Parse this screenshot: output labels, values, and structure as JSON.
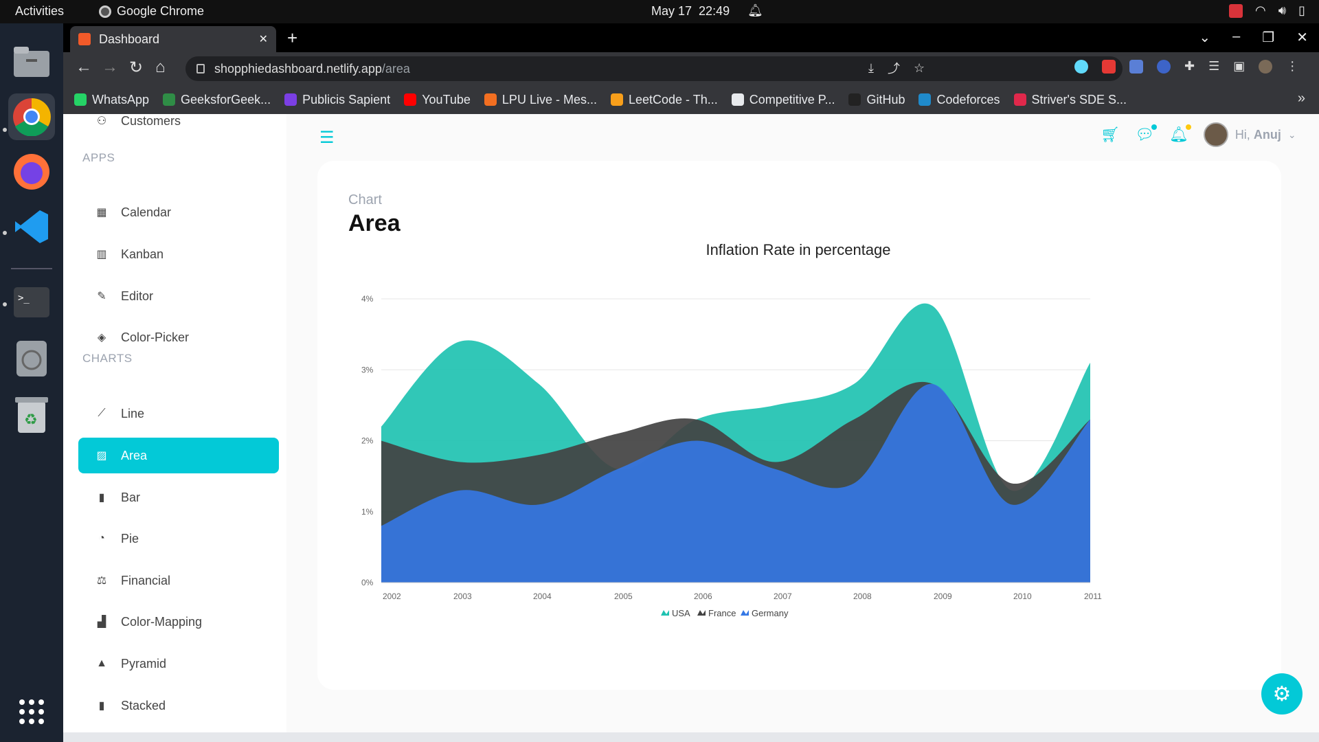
{
  "os": {
    "activities": "Activities",
    "app_name": "Google Chrome",
    "date": "May 17",
    "time": "22:49"
  },
  "browser": {
    "tab_title": "Dashboard",
    "url_host": "shopphiedashboard.netlify.app",
    "url_path": "/area",
    "bookmarks": [
      {
        "label": "WhatsApp",
        "color": "#25d366"
      },
      {
        "label": "GeeksforGeek...",
        "color": "#2f8d46"
      },
      {
        "label": "Publicis Sapient",
        "color": "#7b3fe4"
      },
      {
        "label": "YouTube",
        "color": "#ff0000"
      },
      {
        "label": "LPU Live - Mes...",
        "color": "#f36f21"
      },
      {
        "label": "LeetCode - Th...",
        "color": "#f89f1b"
      },
      {
        "label": "Competitive P...",
        "color": "#e8eaed"
      },
      {
        "label": "GitHub",
        "color": "#222222"
      },
      {
        "label": "Codeforces",
        "color": "#1f8acb"
      },
      {
        "label": "Striver's SDE S...",
        "color": "#e0284b"
      }
    ]
  },
  "sidebar": {
    "items_top": [
      {
        "label": "Customers",
        "icon": "customers-icon",
        "glyph": "⚇"
      }
    ],
    "apps_title": "APPS",
    "apps": [
      {
        "label": "Calendar",
        "icon": "calendar-icon",
        "glyph": "▦"
      },
      {
        "label": "Kanban",
        "icon": "kanban-icon",
        "glyph": "▥"
      },
      {
        "label": "Editor",
        "icon": "editor-icon",
        "glyph": "✎"
      },
      {
        "label": "Color-Picker",
        "icon": "color-picker-icon",
        "glyph": "◈"
      }
    ],
    "charts_title": "CHARTS",
    "charts": [
      {
        "label": "Line",
        "icon": "line-chart-icon",
        "glyph": "⟋"
      },
      {
        "label": "Area",
        "icon": "area-chart-icon",
        "glyph": "▨",
        "active": true
      },
      {
        "label": "Bar",
        "icon": "bar-chart-icon",
        "glyph": "▮"
      },
      {
        "label": "Pie",
        "icon": "pie-chart-icon",
        "glyph": "◔"
      },
      {
        "label": "Financial",
        "icon": "financial-icon",
        "glyph": "⚖"
      },
      {
        "label": "Color-Mapping",
        "icon": "color-mapping-icon",
        "glyph": "▟"
      },
      {
        "label": "Pyramid",
        "icon": "pyramid-icon",
        "glyph": "▲"
      },
      {
        "label": "Stacked",
        "icon": "stacked-chart-icon",
        "glyph": "▮"
      }
    ]
  },
  "header": {
    "greeting": "Hi,",
    "user_name": "Anuj"
  },
  "card": {
    "subtitle": "Chart",
    "title": "Area"
  },
  "chart_data": {
    "type": "area",
    "title": "Inflation Rate in percentage",
    "x": [
      2002,
      2003,
      2004,
      2005,
      2006,
      2007,
      2008,
      2009,
      2010,
      2011
    ],
    "ylim": [
      0,
      4
    ],
    "yticks": [
      "0%",
      "1%",
      "2%",
      "3%",
      "4%"
    ],
    "grid": true,
    "legend": "bottom-center",
    "series": [
      {
        "name": "USA",
        "color": "#1fc2b1",
        "values": [
          2.2,
          3.4,
          2.8,
          1.6,
          2.3,
          2.5,
          2.8,
          3.9,
          1.3,
          3.1
        ]
      },
      {
        "name": "France",
        "color": "#424242",
        "values": [
          2.0,
          1.7,
          1.8,
          2.1,
          2.3,
          1.7,
          2.3,
          2.8,
          1.4,
          2.3
        ]
      },
      {
        "name": "Germany",
        "color": "#3578e5",
        "values": [
          0.8,
          1.3,
          1.1,
          1.6,
          2.0,
          1.6,
          1.4,
          2.8,
          1.1,
          2.3
        ]
      }
    ]
  }
}
